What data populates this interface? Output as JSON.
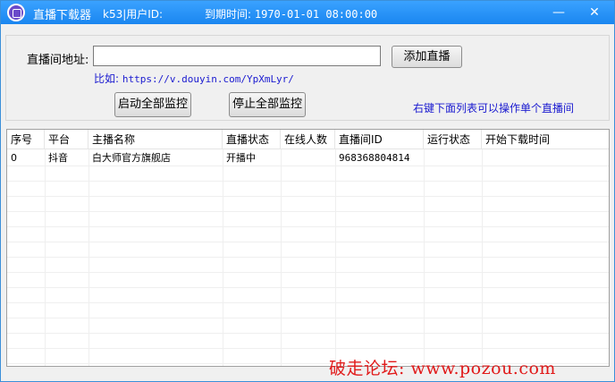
{
  "window": {
    "title": "直播下载器",
    "user_label": "k53|用户ID:",
    "expire_label": "到期时间:",
    "expire_value": "1970-01-01 08:00:00",
    "minimize_glyph": "—",
    "close_glyph": "✕"
  },
  "form": {
    "url_label": "直播间地址:",
    "url_value": "",
    "add_button": "添加直播",
    "example_prefix": "比如:",
    "example_url": "https://v.douyin.com/YpXmLyr/",
    "start_all_button": "启动全部监控",
    "stop_all_button": "停止全部监控",
    "hint": "右键下面列表可以操作单个直播间"
  },
  "table": {
    "columns": [
      "序号",
      "平台",
      "主播名称",
      "直播状态",
      "在线人数",
      "直播间ID",
      "运行状态",
      "开始下载时间"
    ],
    "rows": [
      [
        "0",
        "抖音",
        "白大师官方旗舰店",
        "开播中",
        "",
        "968368804814",
        "",
        ""
      ]
    ]
  },
  "watermark": "破走论坛: www.pozou.com",
  "colors": {
    "titlebar": "#1a86f0",
    "hint_text": "#1a1ad0",
    "watermark": "#e11919"
  }
}
